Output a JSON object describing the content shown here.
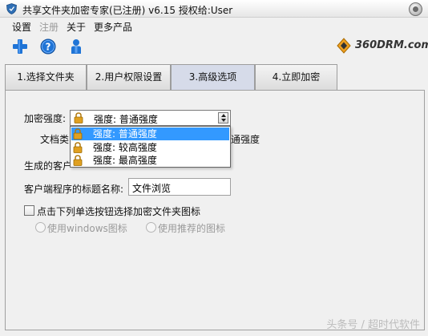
{
  "window": {
    "title": "共享文件夹加密专家(已注册) v6.15  授权给:User"
  },
  "menu": {
    "items": [
      {
        "label": "设置",
        "disabled": false
      },
      {
        "label": "注册",
        "disabled": true
      },
      {
        "label": "关于",
        "disabled": false
      },
      {
        "label": "更多产品",
        "disabled": false
      }
    ]
  },
  "toolbar": {
    "icons": [
      "add-icon",
      "help-icon",
      "user-icon"
    ]
  },
  "brand": {
    "logo_text": "360DRM.com",
    "accent": "#f0a020"
  },
  "tabs": [
    {
      "label": "1.选择文件夹",
      "active": false
    },
    {
      "label": "2.用户权限设置",
      "active": false
    },
    {
      "label": "3.高级选项",
      "active": true
    },
    {
      "label": "4.立即加密",
      "active": false
    }
  ],
  "advanced": {
    "strength_label": "加密强度:",
    "strength_value": "强度: 普通强度",
    "strength_options": [
      "强度: 普通强度",
      "强度: 较高强度",
      "强度: 最高强度"
    ],
    "doc_type_label_partial": "文档类",
    "doc_type_value_partial": "通强度",
    "client_name_label_partial": "生成的客户",
    "client_title_label": "客户端程序的标题名称:",
    "client_title_value": "文件浏览",
    "icon_checkbox_label": "点击下列单选按钮选择加密文件夹图标",
    "radio_windows_icon": "使用windows图标",
    "radio_recommended_icon": "使用推荐的图标"
  },
  "watermark": "头条号 / 超时代软件",
  "colors": {
    "selection": "#3399ff",
    "active_tab": "#d6dbe9",
    "lock_gold": "#e0a020"
  }
}
